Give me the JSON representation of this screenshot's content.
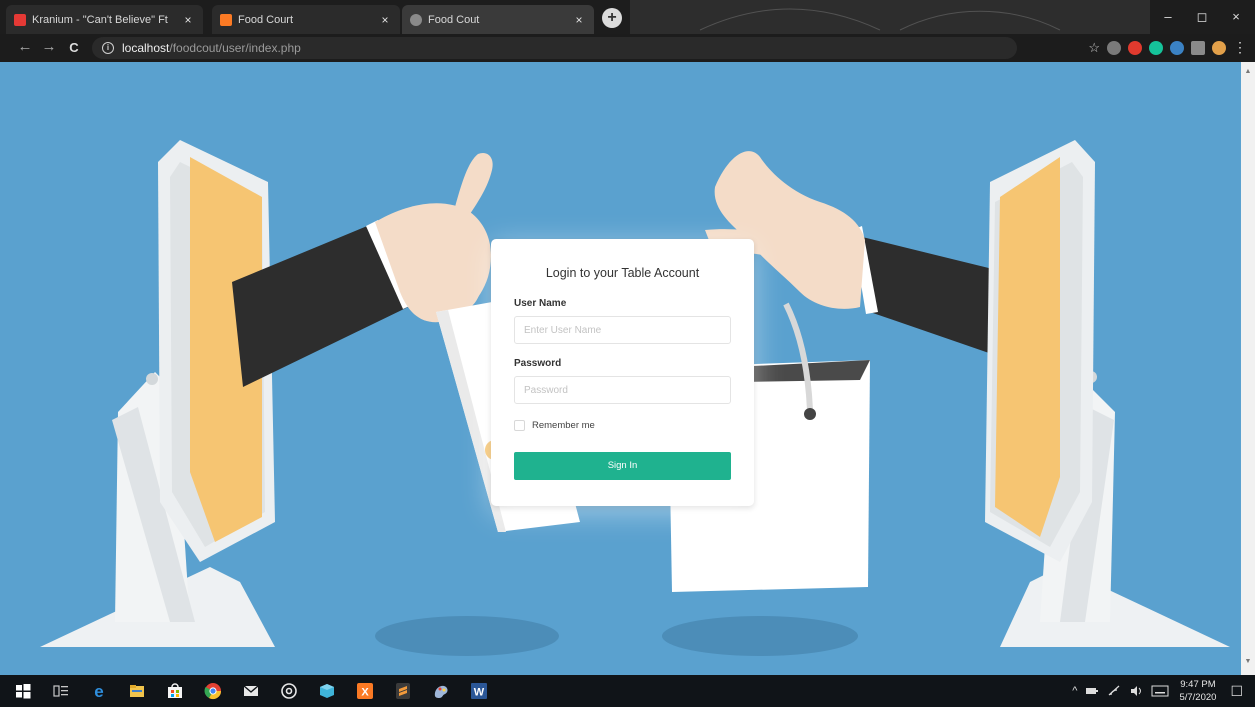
{
  "browser": {
    "tabs": [
      {
        "title": "Kranium - \"Can't Believe\" Ft",
        "favicon_color": "#e53935",
        "active": false
      },
      {
        "title": "Food Court",
        "favicon_color": "#fb7a24",
        "active": false
      },
      {
        "title": "Food Cout",
        "favicon_color": "#8a8a8a",
        "active": true
      }
    ],
    "tab_close_glyph": "×",
    "new_tab_glyph": "+",
    "window_controls": {
      "minimize": "–",
      "maximize": "◻",
      "close": "×"
    },
    "nav": {
      "back": "←",
      "forward": "→",
      "reload": "C"
    },
    "url_host": "localhost",
    "url_path": "/foodcout/user/index.php",
    "info_glyph": "i",
    "star_glyph": "☆",
    "menu_glyph": "⋮",
    "extensions": [
      {
        "name": "help-extension-icon",
        "color": "#7a7a7a"
      },
      {
        "name": "opera-extension-icon",
        "color": "#e03a2e"
      },
      {
        "name": "grammarly-extension-icon",
        "color": "#15c39a"
      },
      {
        "name": "globe-extension-icon",
        "color": "#3b82c4"
      },
      {
        "name": "playlist-extension-icon",
        "color": "#8a8a8a"
      },
      {
        "name": "avatar-extension-icon",
        "color": "#e2a04a"
      }
    ]
  },
  "login": {
    "title": "Login to your Table Account",
    "username_label": "User Name",
    "username_placeholder": "Enter User Name",
    "password_label": "Password",
    "password_placeholder": "Password",
    "remember_label": "Remember me",
    "signin_label": "Sign In"
  },
  "taskbar": {
    "apps": [
      {
        "name": "windows-start-icon",
        "color": "#ffffff"
      },
      {
        "name": "task-view-icon",
        "color": "#c8c8c8"
      },
      {
        "name": "edge-icon",
        "color": "#2f8fdd"
      },
      {
        "name": "file-explorer-icon",
        "color": "#f1c44c"
      },
      {
        "name": "store-icon",
        "color": "#f5f5f5"
      },
      {
        "name": "chrome-icon",
        "color": "#e34133"
      },
      {
        "name": "mail-icon",
        "color": "#e8e8e8"
      },
      {
        "name": "groove-icon",
        "color": "#e8e8e8"
      },
      {
        "name": "app-cube-icon",
        "color": "#3fb4d9"
      },
      {
        "name": "xampp-icon",
        "color": "#fb7a24"
      },
      {
        "name": "sublime-icon",
        "color": "#f29a3b"
      },
      {
        "name": "paint-icon",
        "color": "#9fb7d9"
      },
      {
        "name": "word-icon",
        "color": "#2b5797"
      }
    ],
    "tray_glyph": "^",
    "time": "9:47 PM",
    "date": "5/7/2020",
    "notification_glyph": "☐"
  },
  "colors": {
    "page_background": "#5aa1cf",
    "signin_button": "#1fb28f",
    "monitor_screen": "#f6c572",
    "sleeve": "#2d2d2d",
    "skin": "#f4dcc8"
  }
}
